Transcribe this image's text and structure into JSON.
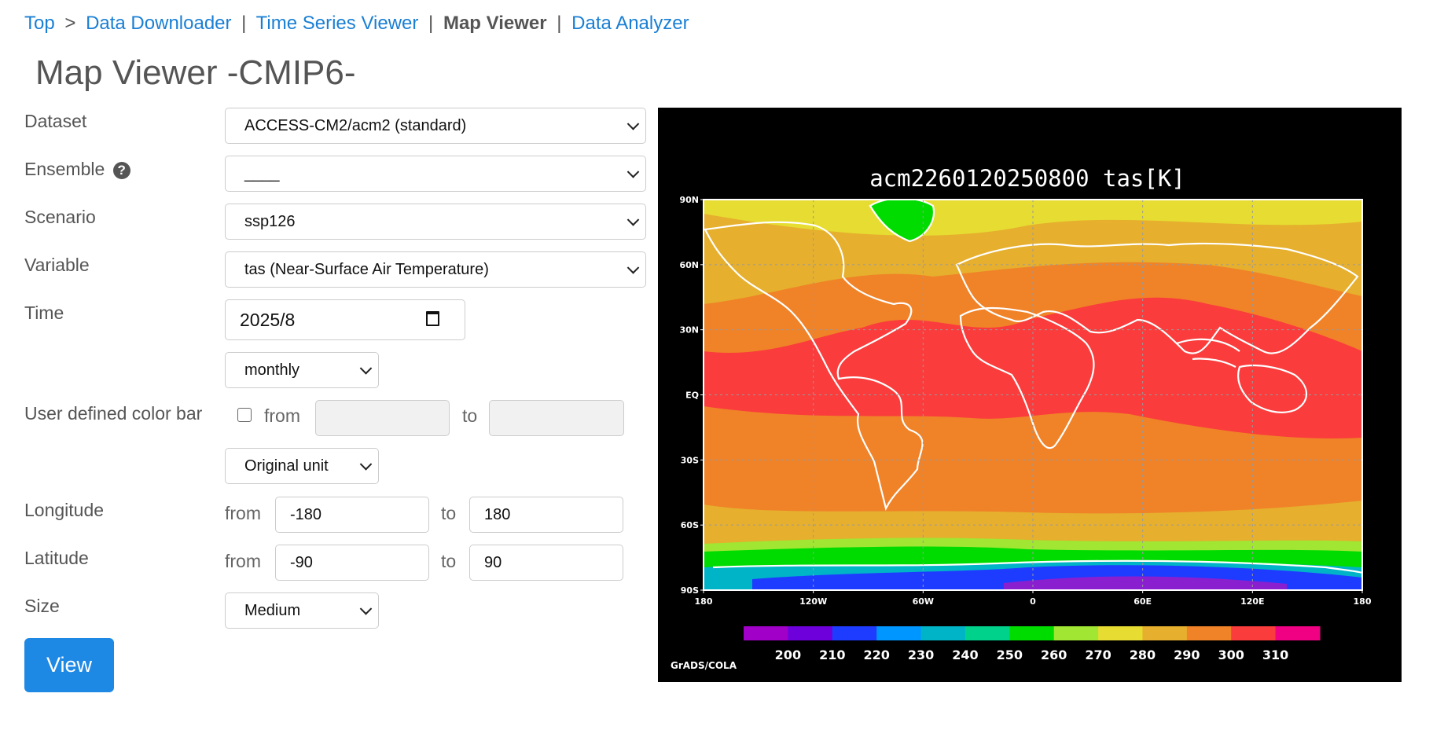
{
  "breadcrumb": {
    "top": "Top",
    "sep1": ">",
    "downloader": "Data Downloader",
    "sep2": "|",
    "timeseries": "Time Series Viewer",
    "sep3": "|",
    "mapviewer": "Map Viewer",
    "sep4": "|",
    "analyzer": "Data Analyzer"
  },
  "title": "Map Viewer -CMIP6-",
  "form": {
    "dataset": {
      "label": "Dataset",
      "value": "ACCESS-CM2/acm2 (standard)"
    },
    "ensemble": {
      "label": "Ensemble",
      "value": "____",
      "help_icon": "question-circle-icon"
    },
    "scenario": {
      "label": "Scenario",
      "value": "ssp126"
    },
    "variable": {
      "label": "Variable",
      "value": "tas (Near-Surface Air Temperature)"
    },
    "time": {
      "label": "Time",
      "value": "2025/8",
      "interval": "monthly",
      "picker_icon": "calendar-icon"
    },
    "colorbar": {
      "label": "User defined color bar",
      "from": "from",
      "to": "to",
      "from_value": "",
      "to_value": "",
      "checked": false,
      "unit": "Original unit"
    },
    "longitude": {
      "label": "Longitude",
      "from": "from",
      "to": "to",
      "from_value": "-180",
      "to_value": "180"
    },
    "latitude": {
      "label": "Latitude",
      "from": "from",
      "to": "to",
      "from_value": "-90",
      "to_value": "90"
    },
    "size": {
      "label": "Size",
      "value": "Medium"
    },
    "view_button": "View"
  },
  "map": {
    "title": "acm2260120250800  tas[K]",
    "lat_labels": [
      "90N",
      "60N",
      "30N",
      "EQ",
      "30S",
      "60S",
      "90S"
    ],
    "lon_labels": [
      "180",
      "120W",
      "60W",
      "0",
      "60E",
      "120E",
      "180"
    ],
    "colorbar_labels": [
      "200",
      "210",
      "220",
      "230",
      "240",
      "250",
      "260",
      "270",
      "280",
      "290",
      "300",
      "310"
    ],
    "colorbar_colors": [
      "#a000c8",
      "#6e00dc",
      "#1e3cff",
      "#0096ff",
      "#00b4c8",
      "#00d28c",
      "#00dc00",
      "#a0e632",
      "#e6dc32",
      "#e6af2d",
      "#f08228",
      "#fa3c3c",
      "#f00082"
    ],
    "credit": "GrADS/COLA",
    "colors": {
      "cold_purple": "#8a1fd0",
      "blue": "#1e3cff",
      "cyan": "#00b4c8",
      "green": "#00dc00",
      "lightgreen": "#a0e632",
      "yellow": "#e6dc32",
      "gold": "#e6af2d",
      "orange": "#f08228",
      "red": "#fa3c3c",
      "magenta": "#f00082"
    }
  }
}
